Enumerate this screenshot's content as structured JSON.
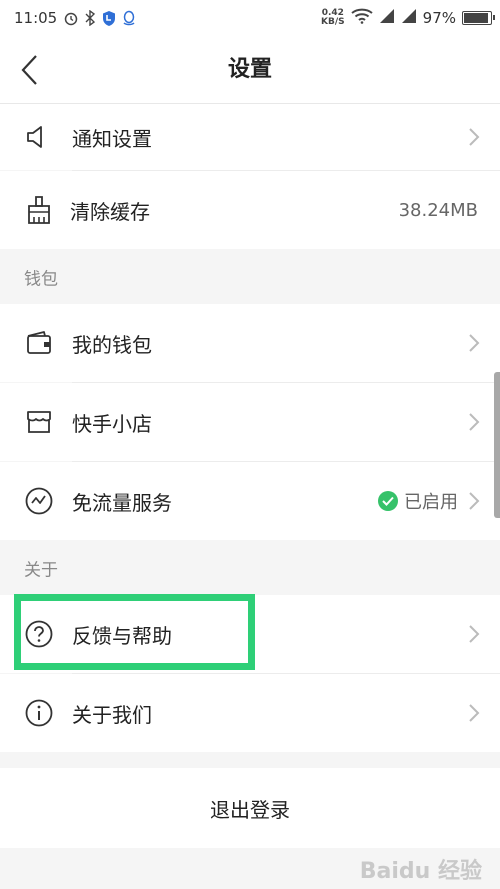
{
  "status_bar": {
    "time": "11:05",
    "net_speed_value": "0.42",
    "net_speed_unit": "KB/S",
    "battery_text": "97%",
    "battery_level": 0.97
  },
  "header": {
    "title": "设置"
  },
  "settings": {
    "notify": {
      "label": "通知设置",
      "icon": "speaker-icon"
    },
    "clear_cache": {
      "label": "清除缓存",
      "value": "38.24MB",
      "icon": "broom-icon"
    }
  },
  "wallet_section": {
    "header": "钱包",
    "items": [
      {
        "label": "我的钱包",
        "icon": "wallet-icon"
      },
      {
        "label": "快手小店",
        "icon": "shop-icon"
      },
      {
        "label": "免流量服务",
        "status": "已启用",
        "icon": "data-service-icon"
      }
    ]
  },
  "about_section": {
    "header": "关于",
    "items": [
      {
        "label": "反馈与帮助",
        "icon": "help-icon"
      },
      {
        "label": "关于我们",
        "icon": "info-icon"
      }
    ]
  },
  "logout_label": "退出登录",
  "watermark": "Baidu 经验",
  "colors": {
    "accent_green": "#2ecf77",
    "enabled_green": "#36c26a",
    "background": "#f5f5f5"
  }
}
